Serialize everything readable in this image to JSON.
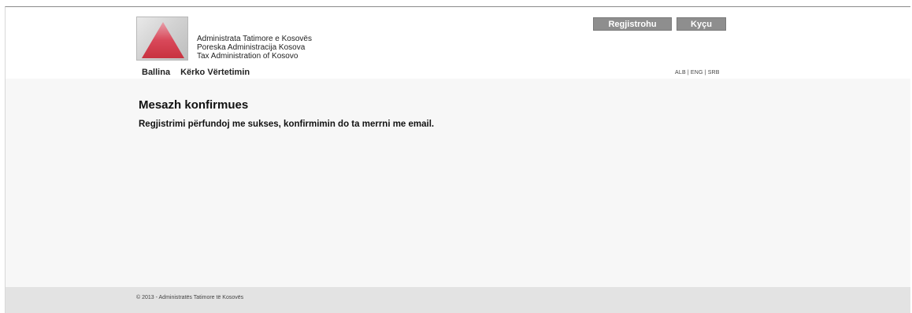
{
  "header": {
    "org_names": [
      "Administrata Tatimore e Kosovës",
      "Poreska Administracija Kosova",
      "Tax Administration of Kosovo"
    ],
    "register_label": "Regjistrohu",
    "login_label": "Kyçu"
  },
  "nav": {
    "items": [
      "Ballina",
      "Kërko Vërtetimin"
    ]
  },
  "languages": {
    "items": [
      "ALB",
      "ENG",
      "SRB"
    ],
    "separator": "|"
  },
  "main": {
    "title": "Mesazh konfirmues",
    "message": "Regjistrimi përfundoj me sukses, konfirmimin do ta merrni me email."
  },
  "footer": {
    "copyright": "© 2013 - Administratës Tatimore të Kosovës"
  },
  "colors": {
    "logo_triangle": "#d9495a",
    "button_bg": "#8e8e8e",
    "content_bg": "#f7f7f7",
    "footer_bg": "#e3e3e3"
  }
}
